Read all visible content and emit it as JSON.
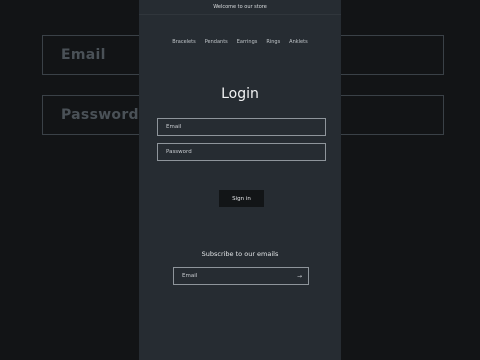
{
  "background": {
    "email_label": "Email",
    "password_label": "Password"
  },
  "announcement": "Welcome to our store",
  "nav": [
    "Bracelets",
    "Pendants",
    "Earrings",
    "Rings",
    "Anklets"
  ],
  "login": {
    "title": "Login",
    "email_placeholder": "Email",
    "password_placeholder": "Password",
    "signin_label": "Sign in"
  },
  "newsletter": {
    "title": "Subscribe to our emails",
    "email_placeholder": "Email",
    "submit_icon": "arrow-right-icon"
  },
  "colors": {
    "page_background": "#121416",
    "panel_background": "#262c32",
    "button_background": "#121517",
    "border": "#8e959b"
  }
}
